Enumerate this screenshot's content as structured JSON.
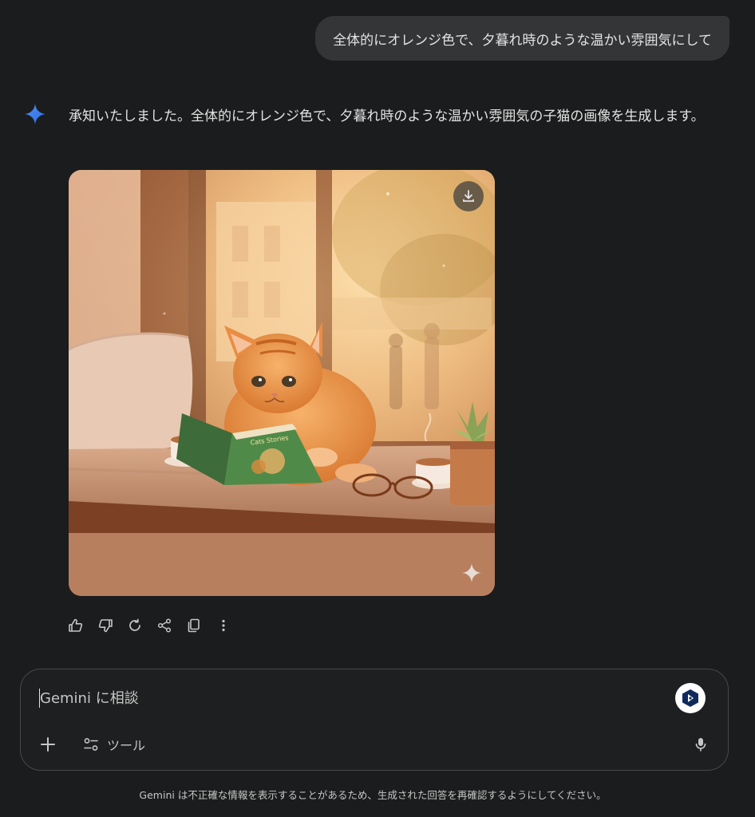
{
  "chat": {
    "user_message": "全体的にオレンジ色で、夕暮れ時のような温かい雰囲気にして",
    "assistant_message": "承知いたしました。全体的にオレンジ色で、夕暮れ時のような温かい雰囲気の子猫の画像を生成します。",
    "image": {
      "book_title": "Cats Stories",
      "download_icon": "download-icon",
      "watermark_icon": "gemini-sparkle-icon"
    },
    "actions": [
      "thumb-up-icon",
      "thumb-down-icon",
      "regenerate-icon",
      "share-icon",
      "copy-icon",
      "more-vert-icon"
    ]
  },
  "input": {
    "placeholder": "Gemini に相談",
    "tools_label": "ツール",
    "plus_icon": "plus-icon",
    "mic_icon": "mic-icon"
  },
  "footer": {
    "disclaimer": "Gemini は不正確な情報を表示することがあるため、生成された回答を再確認するようにしてください。"
  },
  "colors": {
    "background": "#1b1c1d",
    "bubble": "#333537",
    "text": "#e3e3e3",
    "accent_blue": "#4285f4"
  }
}
